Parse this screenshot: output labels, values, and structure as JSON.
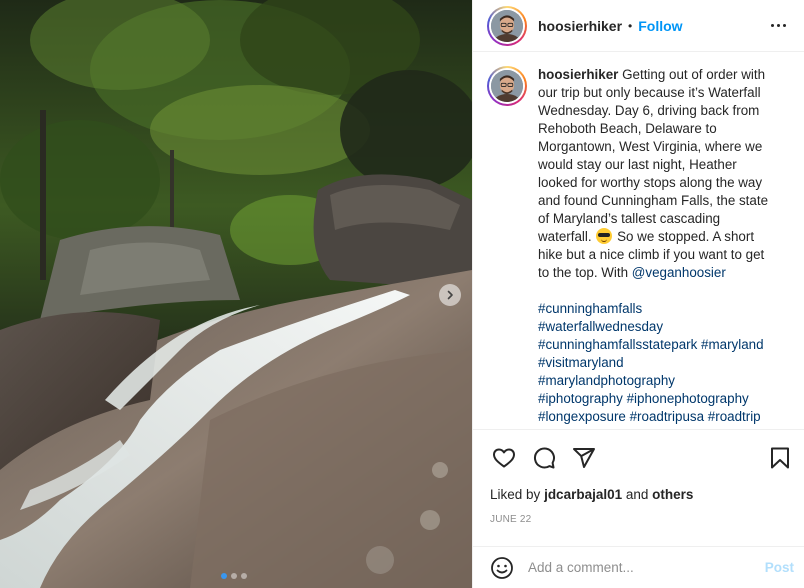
{
  "post": {
    "author": "hoosierhiker",
    "separator": "•",
    "follow_label": "Follow",
    "more_icon": "more-horizontal-icon"
  },
  "caption": {
    "username": "hoosierhiker",
    "text_before_emoji": "Getting out of order with our trip but only because it’s Waterfall Wednesday. Day 6, driving back from Rehoboth Beach, Delaware to Morgantown, West Virginia, where we would stay our last night, Heather looked for worthy stops along the way and found Cunningham Falls, the state of Maryland’s tallest cascading waterfall.",
    "emoji": "sunglasses-emoji",
    "text_after_emoji": "So we stopped. A short hike but a nice climb if you want to get to the top. With",
    "mention": "@veganhoosier",
    "hashtags": [
      "#cunninghamfalls",
      "#waterfallwednesday",
      "#cunninghamfallsstatepark",
      "#maryland",
      "#visitmaryland",
      "#marylandphotography",
      "#iphotography",
      "#iphonephotography",
      "#longexposure",
      "#roadtripusa",
      "#roadtrip"
    ]
  },
  "actions": {
    "like_icon": "heart-icon",
    "comment_icon": "comment-icon",
    "share_icon": "share-icon",
    "save_icon": "bookmark-icon"
  },
  "likes": {
    "prefix": "Liked by",
    "user": "jdcarbajal01",
    "conjunction": "and",
    "others": "others"
  },
  "date": "JUNE 22",
  "comment": {
    "placeholder": "Add a comment...",
    "post_label": "Post",
    "emoji_icon": "smiley-icon"
  },
  "carousel": {
    "slide_count": 3,
    "active_index": 0,
    "next_icon": "chevron-right-icon"
  },
  "colors": {
    "accent": "#0095f6",
    "link": "#00376b",
    "muted": "#8e8e8e",
    "post_disabled": "#b2dffc"
  }
}
